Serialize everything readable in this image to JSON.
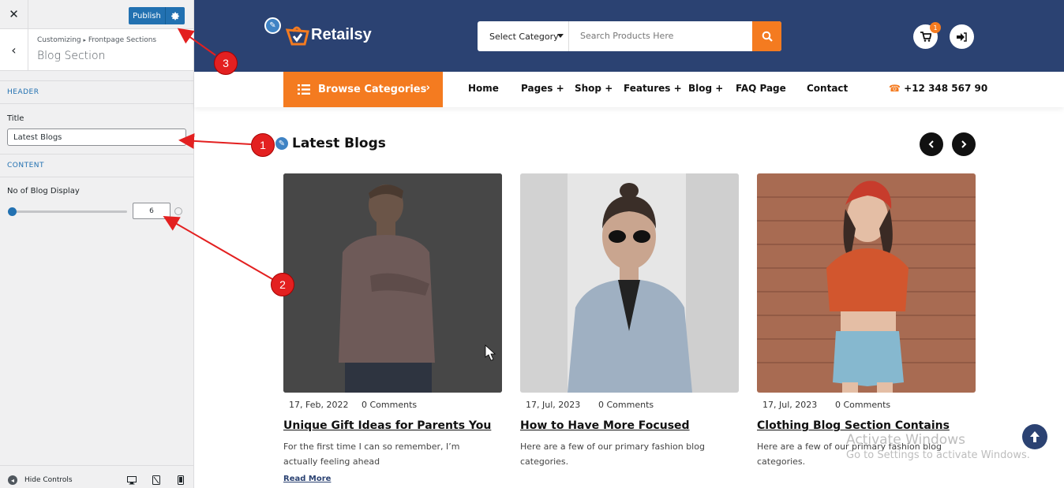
{
  "customizer": {
    "publish_label": "Publish",
    "breadcrumb_root": "Customizing",
    "breadcrumb_sep": "▸",
    "breadcrumb_parent": "Frontpage Sections",
    "section_title": "Blog Section",
    "group_header": "HEADER",
    "title_label": "Title",
    "title_value": "Latest Blogs",
    "group_content": "CONTENT",
    "count_label": "No of Blog Display",
    "count_value": "6",
    "hide_controls": "Hide Controls"
  },
  "site": {
    "logo_text": "Retailsy",
    "category_select": "Select Category",
    "search_placeholder": "Search Products Here",
    "cart_count": "1",
    "browse_label": "Browse Categories",
    "nav": [
      "Home",
      "Pages +",
      "Shop +",
      "Features +",
      "Blog +",
      "FAQ Page",
      "Contact"
    ],
    "phone": "+12 348 567 90",
    "blogs_heading": "Latest Blogs",
    "posts": [
      {
        "date": "17, Feb, 2022",
        "comments": "0 Comments",
        "title": "Unique Gift Ideas for Parents You",
        "excerpt": "For the first time I can so remember, I’m actually feeling ahead",
        "read_more": "Read More"
      },
      {
        "date": "17, Jul, 2023",
        "comments": "0 Comments",
        "title": "How to Have More Focused",
        "excerpt": "Here are a few of our primary fashion blog categories."
      },
      {
        "date": "17, Jul, 2023",
        "comments": "0 Comments",
        "title": "Clothing Blog Section Contains",
        "excerpt": "Here are a few of our primary fashion blog categories."
      }
    ]
  },
  "windows_notice": {
    "line1": "Activate Windows",
    "line2": "Go to Settings to activate Windows."
  },
  "annotations": [
    "1",
    "2",
    "3"
  ],
  "colors": {
    "header_bg": "#2b4272",
    "accent_orange": "#f47b20",
    "wp_blue": "#2271b1",
    "annotation_red": "#e32020"
  }
}
